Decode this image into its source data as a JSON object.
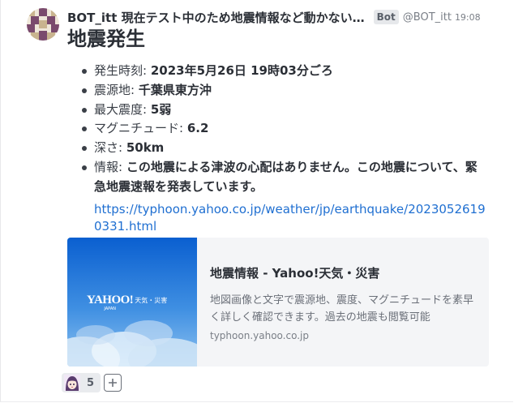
{
  "message": {
    "display_name": "BOT_itt 現在テスト中のため地震情報など動かない…",
    "bot_badge": "Bot",
    "handle": "@BOT_itt",
    "time": "19:08",
    "title": "地震発生",
    "details": [
      {
        "label": "発生時刻: ",
        "value": "2023年5月26日 19時03分ごろ"
      },
      {
        "label": "震源地: ",
        "value": "千葉県東方沖"
      },
      {
        "label": "最大震度: ",
        "value": "5弱"
      },
      {
        "label": "マグニチュード: ",
        "value": "6.2"
      },
      {
        "label": "深さ: ",
        "value": "50km"
      }
    ],
    "info": {
      "label": "情報: ",
      "text": "この地震による津波の心配はありません。この地震について、緊急地震速報を発表しています。",
      "link": "https://typhoon.yahoo.co.jp/weather/jp/earthquake/20230526190331.html"
    },
    "card": {
      "thumb_logo": "YAHOO!",
      "thumb_logo_sub": "JAPAN",
      "thumb_label": "天気・災害",
      "title": "地震情報 - Yahoo!天気・災害",
      "description": "地図画像と文字で震源地、震度、マグニチュードを素早く詳しく確認できます。過去の地震も閲覧可能",
      "domain": "typhoon.yahoo.co.jp"
    },
    "reactions": [
      {
        "icon": "anime-girl-emoji-icon",
        "count": "5"
      }
    ],
    "add_reaction_icon": "plus-icon"
  },
  "colors": {
    "link": "#1f6fd1",
    "badge_bg": "#e6e8eb",
    "card_bg": "#f4f5f7",
    "sky_top": "#0a5fd0",
    "sky_bottom": "#8ec2f0"
  }
}
